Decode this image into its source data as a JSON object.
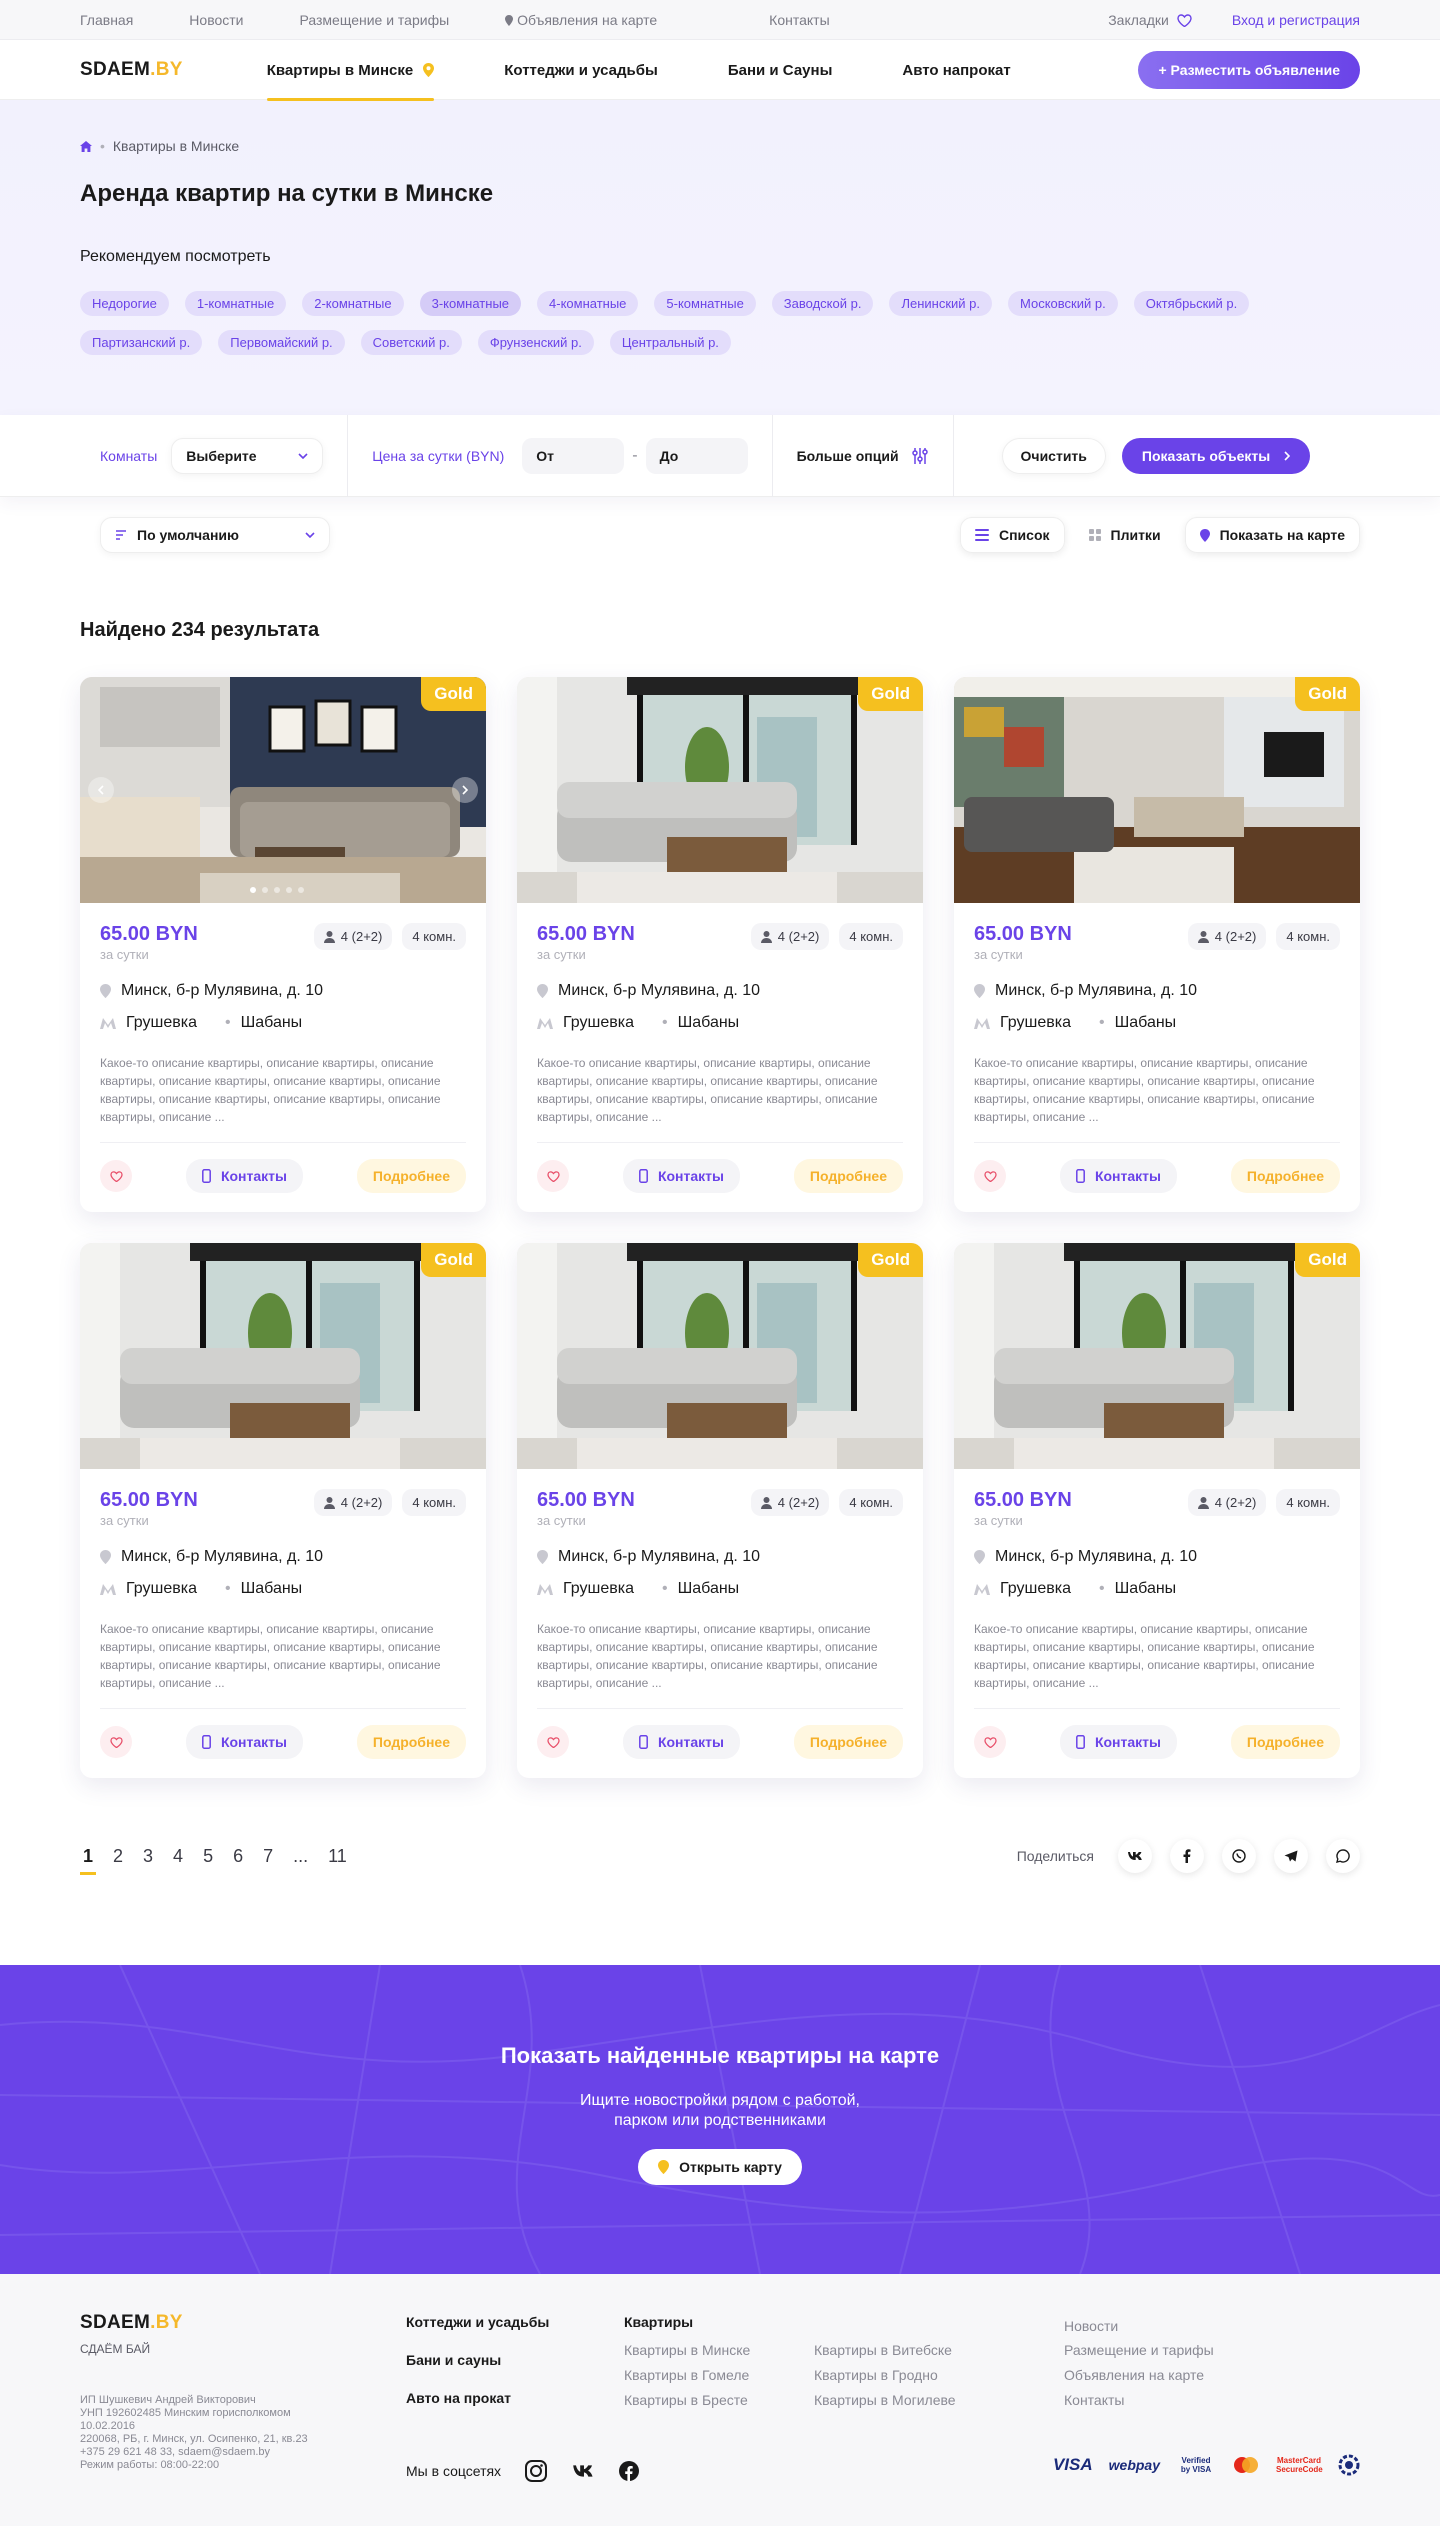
{
  "topbar": {
    "links": [
      "Главная",
      "Новости",
      "Размещение и тарифы",
      "Объявления на карте",
      "Контакты"
    ],
    "bookmarks": "Закладки",
    "login": "Вход и регистрация"
  },
  "header": {
    "logo_main": "SDAEM",
    "logo_suffix": ".BY",
    "nav": [
      "Квартиры в Минске",
      "Коттеджи и усадьбы",
      "Бани и Сауны",
      "Авто напрокат"
    ],
    "place_button": "+ Разместить объявление"
  },
  "hero": {
    "breadcrumb": "Квартиры в Минске",
    "title": "Аренда квартир на сутки в Минске",
    "recommend": "Рекомендуем посмотреть",
    "chips": [
      "Недорогие",
      "1-комнатные",
      "2-комнатные",
      "3-комнатные",
      "4-комнатные",
      "5-комнатные",
      "Заводской р.",
      "Ленинский р.",
      "Московский р.",
      "Октябрьский р.",
      "Партизанский р.",
      "Первомайский р.",
      "Советский р.",
      "Фрунзенский р.",
      "Центральный р."
    ]
  },
  "filter": {
    "rooms_label": "Комнаты",
    "rooms_value": "Выберите",
    "price_label": "Цена за сутки (BYN)",
    "from": "От",
    "dash": "-",
    "to": "До",
    "more": "Больше опций",
    "clear": "Очистить",
    "show": "Показать объекты"
  },
  "controls": {
    "sort": "По умолчанию",
    "list": "Список",
    "tiles": "Плитки",
    "map": "Показать на карте"
  },
  "results": {
    "found": "Найдено 234 результата",
    "cards": [
      {
        "badge": "Gold",
        "price": "65.00 BYN",
        "per": "за сутки",
        "guests": "4 (2+2)",
        "rooms": "4 комн.",
        "address": "Минск, б-р Мулявина, д. 10",
        "metro": "Грушевка",
        "district": "Шабаны",
        "desc": "Какое-то описание квартиры, описание квартиры, описание квартиры, описание квартиры, описание квартиры, описание квартиры, описание квартиры, описание квартиры, описание квартиры, описание ...",
        "contacts": "Контакты",
        "more": "Подробнее"
      },
      {
        "badge": "Gold",
        "price": "65.00 BYN",
        "per": "за сутки",
        "guests": "4 (2+2)",
        "rooms": "4 комн.",
        "address": "Минск, б-р Мулявина, д. 10",
        "metro": "Грушевка",
        "district": "Шабаны",
        "desc": "Какое-то описание квартиры, описание квартиры, описание квартиры, описание квартиры, описание квартиры, описание квартиры, описание квартиры, описание квартиры, описание квартиры, описание ...",
        "contacts": "Контакты",
        "more": "Подробнее"
      },
      {
        "badge": "Gold",
        "price": "65.00 BYN",
        "per": "за сутки",
        "guests": "4 (2+2)",
        "rooms": "4 комн.",
        "address": "Минск, б-р Мулявина, д. 10",
        "metro": "Грушевка",
        "district": "Шабаны",
        "desc": "Какое-то описание квартиры, описание квартиры, описание квартиры, описание квартиры, описание квартиры, описание квартиры, описание квартиры, описание квартиры, описание квартиры, описание ...",
        "contacts": "Контакты",
        "more": "Подробнее"
      },
      {
        "badge": "Gold",
        "price": "65.00 BYN",
        "per": "за сутки",
        "guests": "4 (2+2)",
        "rooms": "4 комн.",
        "address": "Минск, б-р Мулявина, д. 10",
        "metro": "Грушевка",
        "district": "Шабаны",
        "desc": "Какое-то описание квартиры, описание квартиры, описание квартиры, описание квартиры, описание квартиры, описание квартиры, описание квартиры, описание квартиры, описание квартиры, описание ...",
        "contacts": "Контакты",
        "more": "Подробнее"
      },
      {
        "badge": "Gold",
        "price": "65.00 BYN",
        "per": "за сутки",
        "guests": "4 (2+2)",
        "rooms": "4 комн.",
        "address": "Минск, б-р Мулявина, д. 10",
        "metro": "Грушевка",
        "district": "Шабаны",
        "desc": "Какое-то описание квартиры, описание квартиры, описание квартиры, описание квартиры, описание квартиры, описание квартиры, описание квартиры, описание квартиры, описание квартиры, описание ...",
        "contacts": "Контакты",
        "more": "Подробнее"
      },
      {
        "badge": "Gold",
        "price": "65.00 BYN",
        "per": "за сутки",
        "guests": "4 (2+2)",
        "rooms": "4 комн.",
        "address": "Минск, б-р Мулявина, д. 10",
        "metro": "Грушевка",
        "district": "Шабаны",
        "desc": "Какое-то описание квартиры, описание квартиры, описание квартиры, описание квартиры, описание квартиры, описание квартиры, описание квартиры, описание квартиры, описание квартиры, описание ...",
        "contacts": "Контакты",
        "more": "Подробнее"
      }
    ]
  },
  "pagination": {
    "pages": [
      "1",
      "2",
      "3",
      "4",
      "5",
      "6",
      "7",
      "...",
      "11"
    ],
    "share": "Поделиться"
  },
  "promo": {
    "title": "Показать найденные квартиры на карте",
    "line1": "Ищите новостройки рядом с работой,",
    "line2": "парком или родственниками",
    "button": "Открыть карту"
  },
  "footer": {
    "logo_main": "SDAEM",
    "logo_suffix": ".BY",
    "brand": "СДАЁМ БАЙ",
    "legal": [
      "ИП Шушкевич Андрей Викторович",
      "УНП 192602485 Минским горисполкомом",
      "10.02.2016",
      "220068, РБ, г. Минск, ул. Осипенко, 21, кв.23",
      "+375 29 621 48 33, sdaem@sdaem.by",
      "Режим работы: 08:00-22:00"
    ],
    "col1": [
      "Коттеджи и усадьбы",
      "Бани и сауны",
      "Авто на прокат"
    ],
    "col2_title": "Квартиры",
    "col2": [
      "Квартиры в Минске",
      "Квартиры в Гомеле",
      "Квартиры в Бресте"
    ],
    "col3": [
      "Квартиры в Витебске",
      "Квартиры в Гродно",
      "Квартиры в Могилеве"
    ],
    "col4": [
      "Новости",
      "Размещение и тарифы",
      "Объявления на карте",
      "Контакты"
    ],
    "social_label": "Мы в соцсетях",
    "payments": [
      "VISA",
      "webpay",
      "Verified by VISA",
      "MasterCard SecureCode"
    ]
  },
  "colors": {
    "accent": "#6a43e8",
    "gold": "#f5c01f",
    "hero_bg": "#f2f1fd"
  }
}
